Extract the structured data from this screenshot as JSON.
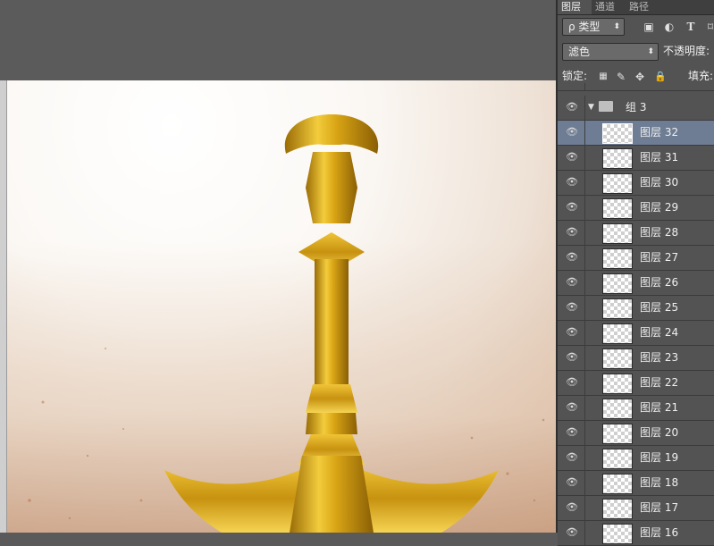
{
  "panel": {
    "tabs": [
      {
        "label": "图层",
        "active": true
      },
      {
        "label": "通道",
        "active": false
      },
      {
        "label": "路径",
        "active": false
      }
    ],
    "filter": {
      "label": "ρ 类型"
    },
    "blend_mode": {
      "value": "滤色"
    },
    "opacity_label": "不透明度:",
    "lock_label": "锁定:",
    "fill_label": "填充:",
    "group": {
      "name": "组 3",
      "expanded": true
    },
    "layers": [
      {
        "name": "图层 32",
        "selected": true
      },
      {
        "name": "图层 31"
      },
      {
        "name": "图层 30"
      },
      {
        "name": "图层 29"
      },
      {
        "name": "图层 28"
      },
      {
        "name": "图层 27"
      },
      {
        "name": "图层 26"
      },
      {
        "name": "图层 25"
      },
      {
        "name": "图层 24"
      },
      {
        "name": "图层 23"
      },
      {
        "name": "图层 22"
      },
      {
        "name": "图层 21"
      },
      {
        "name": "图层 20"
      },
      {
        "name": "图层 19"
      },
      {
        "name": "图层 18"
      },
      {
        "name": "图层 17"
      },
      {
        "name": "图层 16"
      }
    ]
  },
  "colors": {
    "selected_row": "#6e7d94",
    "panel_bg": "#535353",
    "workspace_bg": "#5b5b5b",
    "sword_gold": "#d9a515"
  }
}
